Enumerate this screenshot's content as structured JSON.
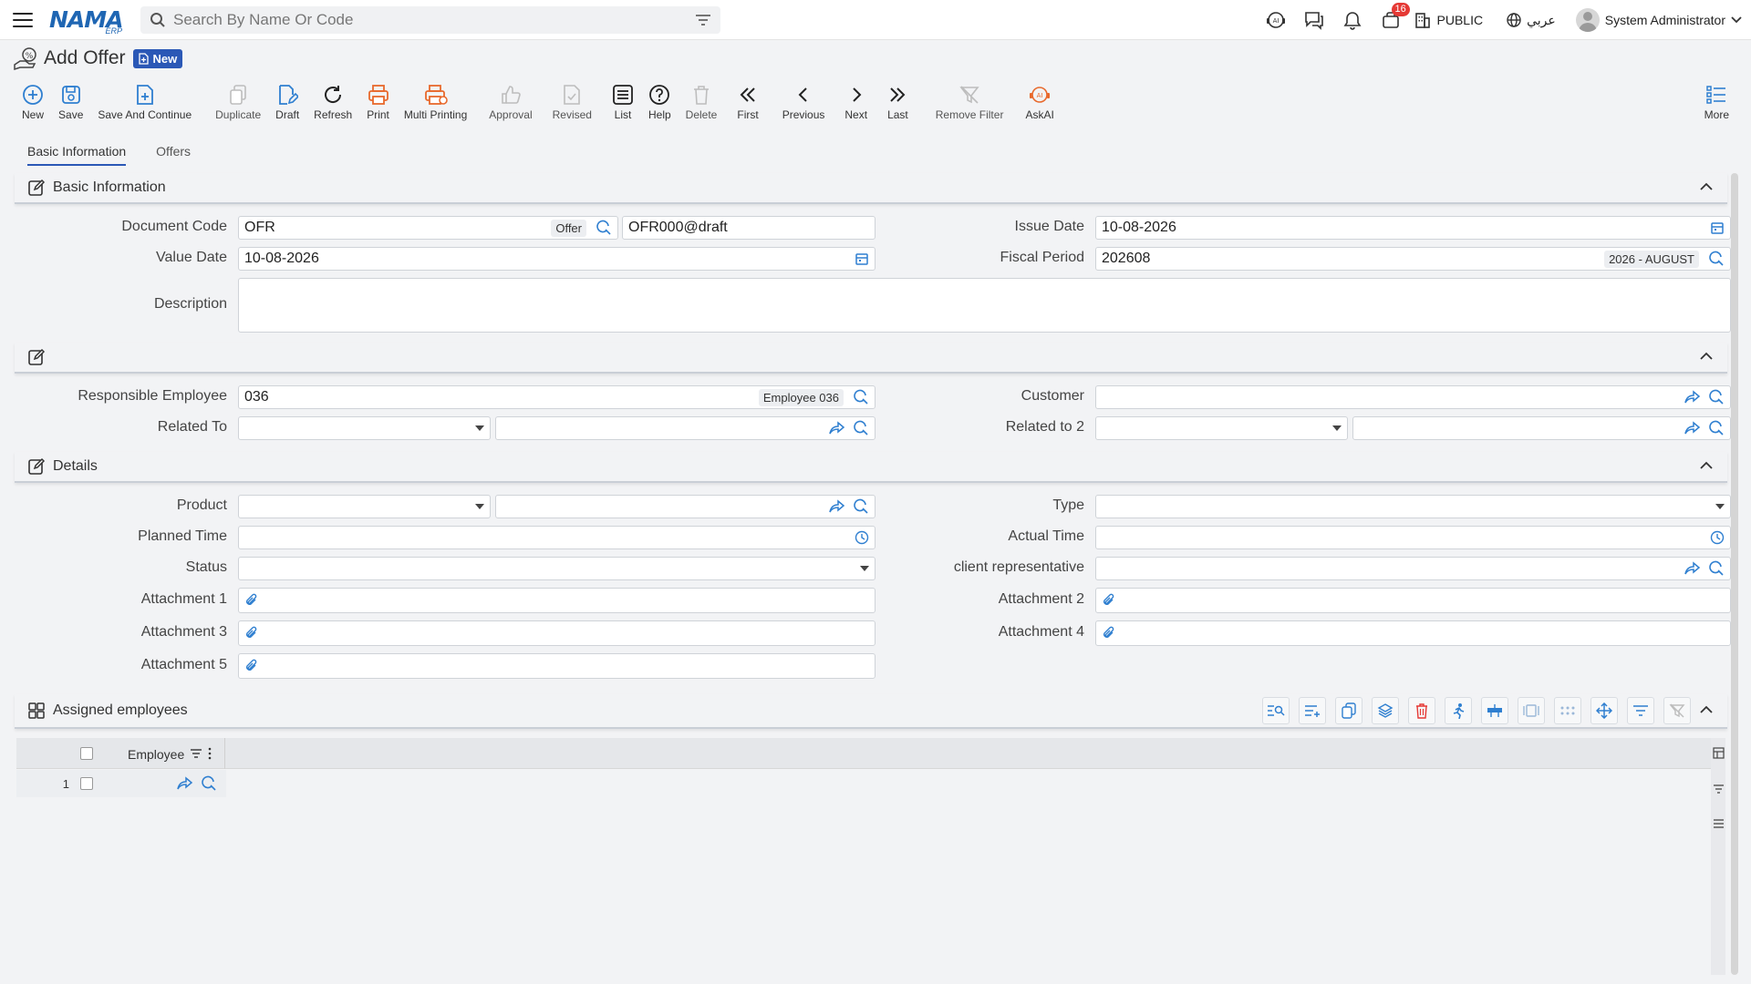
{
  "topbar": {
    "logo_text": "NAMA",
    "logo_sub": "ERP",
    "search_placeholder": "Search By Name Or Code",
    "notification_count": "16",
    "company": "PUBLIC",
    "language": "عربي",
    "user": "System Administrator"
  },
  "page": {
    "title": "Add Offer",
    "status_badge": "New"
  },
  "toolbar": {
    "new": "New",
    "save": "Save",
    "save_continue": "Save And Continue",
    "duplicate": "Duplicate",
    "draft": "Draft",
    "refresh": "Refresh",
    "print": "Print",
    "multi_printing": "Multi Printing",
    "approval": "Approval",
    "revised": "Revised",
    "list": "List",
    "help": "Help",
    "delete": "Delete",
    "first": "First",
    "previous": "Previous",
    "next": "Next",
    "last": "Last",
    "remove_filter": "Remove Filter",
    "askai": "AskAI",
    "more": "More"
  },
  "tabs": {
    "basic": "Basic Information",
    "offers": "Offers"
  },
  "section_basic": {
    "title": "Basic Information",
    "document_code_label": "Document Code",
    "document_code_value": "OFR",
    "document_code_tag": "Offer",
    "document_number": "OFR000@draft",
    "issue_date_label": "Issue Date",
    "issue_date": "10-08-2026",
    "value_date_label": "Value Date",
    "value_date": "10-08-2026",
    "fiscal_period_label": "Fiscal Period",
    "fiscal_period": "202608",
    "fiscal_period_tag": "2026 - AUGUST",
    "description_label": "Description",
    "description": ""
  },
  "section_parties": {
    "responsible_employee_label": "Responsible Employee",
    "responsible_employee": "036",
    "responsible_employee_tag": "Employee 036",
    "customer_label": "Customer",
    "related_to_label": "Related To",
    "related_to2_label": "Related to 2"
  },
  "section_details": {
    "title": "Details",
    "product_label": "Product",
    "type_label": "Type",
    "planned_time_label": "Planned Time",
    "actual_time_label": "Actual Time",
    "status_label": "Status",
    "client_rep_label": "client representative",
    "attachment1_label": "Attachment 1",
    "attachment2_label": "Attachment 2",
    "attachment3_label": "Attachment 3",
    "attachment4_label": "Attachment 4",
    "attachment5_label": "Attachment 5"
  },
  "section_assigned": {
    "title": "Assigned employees",
    "column_employee": "Employee",
    "row_number": "1"
  },
  "colors": {
    "accent": "#2b58b6",
    "icon_blue": "#2f7fd0",
    "icon_orange": "#e8692c",
    "badge_red": "#e53935"
  }
}
